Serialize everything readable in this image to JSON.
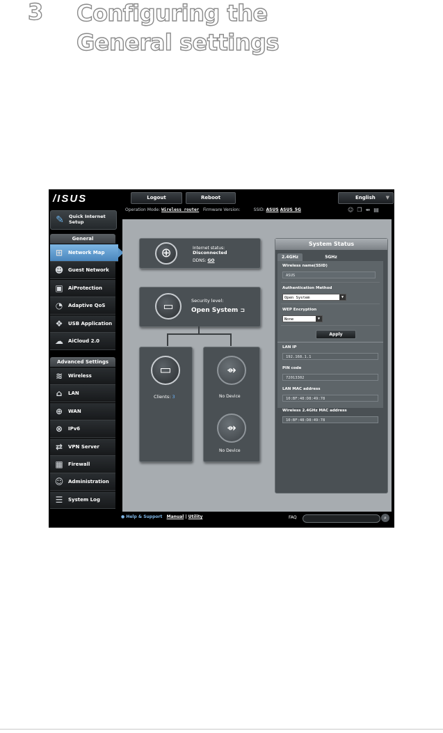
{
  "heading": {
    "number": "3",
    "title": "Configuring the General settings"
  },
  "router": {
    "logo": "/ISUS",
    "buttons": {
      "logout": "Logout",
      "reboot": "Reboot",
      "language": "English"
    },
    "info": {
      "op_mode_label": "Operation Mode:",
      "op_mode_value": "Wireless router",
      "fw_label": "Firmware Version:",
      "ssid_label": "SSID:",
      "ssid_1": "ASUS",
      "ssid_2": "ASUS_5G"
    },
    "sidebar": {
      "quick_setup": "Quick Internet Setup",
      "general_header": "General",
      "general_items": [
        {
          "label": "Network Map",
          "icon": "network-map-icon"
        },
        {
          "label": "Guest Network",
          "icon": "guest-network-icon"
        },
        {
          "label": "AiProtection",
          "icon": "lock-icon"
        },
        {
          "label": "Adaptive QoS",
          "icon": "gauge-icon"
        },
        {
          "label": "USB Application",
          "icon": "puzzle-icon"
        },
        {
          "label": "AiCloud 2.0",
          "icon": "cloud-icon"
        }
      ],
      "advanced_header": "Advanced Settings",
      "advanced_items": [
        {
          "label": "Wireless",
          "icon": "wifi-icon"
        },
        {
          "label": "LAN",
          "icon": "home-icon"
        },
        {
          "label": "WAN",
          "icon": "globe-icon"
        },
        {
          "label": "IPv6",
          "icon": "ipv6-icon"
        },
        {
          "label": "VPN Server",
          "icon": "vpn-icon"
        },
        {
          "label": "Firewall",
          "icon": "firewall-icon"
        },
        {
          "label": "Administration",
          "icon": "user-icon"
        },
        {
          "label": "System Log",
          "icon": "log-icon"
        }
      ]
    },
    "network": {
      "internet_status_label": "Internet status:",
      "internet_status_value": "Disconnected",
      "ddns_label": "DDNS:",
      "ddns_value": "GO",
      "security_label": "Security level:",
      "security_value": "Open System",
      "clients_label": "Clients:",
      "clients_count": "3",
      "usb1": "No Device",
      "usb2": "No Device"
    },
    "status": {
      "title": "System Status",
      "tab_24": "2.4GHz",
      "tab_5": "5GHz",
      "ssid_label": "Wireless name(SSID)",
      "ssid_value": "ASUS",
      "auth_label": "Authentication Method",
      "auth_value": "Open System",
      "wep_label": "WEP Encryption",
      "wep_value": "None",
      "apply": "Apply",
      "lanip_label": "LAN IP",
      "lanip_value": "192.168.1.1",
      "pin_label": "PIN code",
      "pin_value": "72013302",
      "lanmac_label": "LAN MAC address",
      "lanmac_value": "10:BF:48:D8:49:78",
      "wmac_label": "Wireless 2.4GHz MAC address",
      "wmac_value": "10:BF:48:D8:49:78"
    },
    "footer": {
      "help": "Help & Support",
      "manual": "Manual",
      "sep": "|",
      "utility": "Utility",
      "faq": "FAQ"
    }
  }
}
